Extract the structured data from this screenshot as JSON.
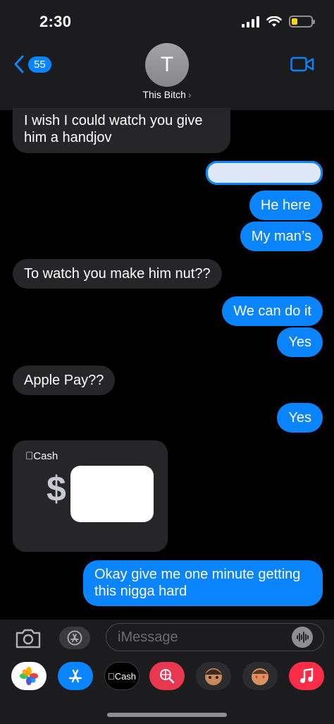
{
  "status_bar": {
    "time": "2:30"
  },
  "header": {
    "back_count": "55",
    "avatar_initial": "T",
    "contact_name": "This Bitch",
    "chevron": "›"
  },
  "messages": [
    {
      "direction": "incoming",
      "text": "I wish I could watch you give him a handjov"
    },
    {
      "direction": "outgoing",
      "text": "He here"
    },
    {
      "direction": "outgoing",
      "text": "My man’s"
    },
    {
      "direction": "incoming",
      "text": "To watch you make him nut??"
    },
    {
      "direction": "outgoing",
      "text": "We can do it"
    },
    {
      "direction": "outgoing",
      "text": "Yes"
    },
    {
      "direction": "incoming",
      "text": "Apple Pay??"
    },
    {
      "direction": "outgoing",
      "text": "Yes"
    },
    {
      "direction": "outgoing",
      "text": "Okay give me one minute getting this nigga hard"
    }
  ],
  "cash_card": {
    "brand": "Cash",
    "currency": "$"
  },
  "input_bar": {
    "placeholder": "iMessage"
  },
  "drawer": {
    "cash_label": "Cash"
  },
  "icons": {
    "back": "chevron-left-icon",
    "video": "video-camera-icon",
    "camera": "camera-icon",
    "apps": "app-store-icon",
    "audio": "audio-waveform-icon",
    "apple": "apple-logo-icon"
  },
  "colors": {
    "accent": "#0a84ff",
    "incoming_bubble": "#262628",
    "battery": "#ffd60a"
  }
}
